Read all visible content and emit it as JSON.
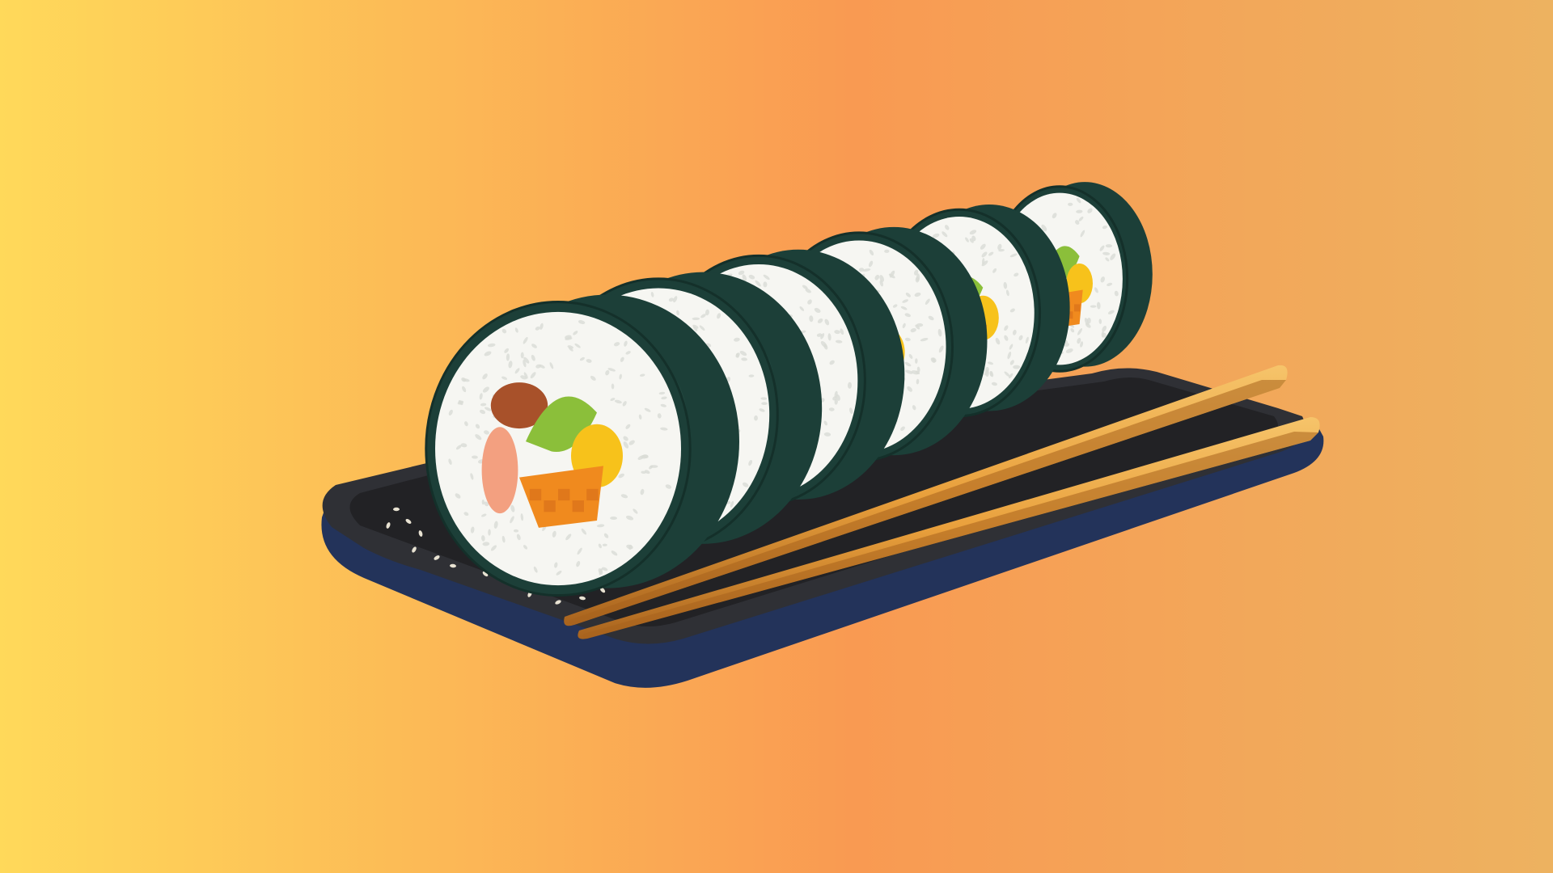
{
  "illustration": {
    "subject": "kimbap-rolls-on-plate-with-chopsticks",
    "slice_count": 6,
    "icons": [
      "kimbap-slice-icon",
      "plate-icon",
      "chopsticks-icon",
      "sesame-seed-icon"
    ]
  },
  "colors": {
    "background_left": "#FFD95A",
    "background_mid": "#F99A52",
    "background_right": "#EDB260",
    "seaweed": "#1C3F38",
    "seaweed_highlight": "#2E5A50",
    "rice": "#F6F6F2",
    "rice_shadow": "#D9DCD6",
    "carrot": "#F08A1E",
    "egg": "#F7C21B",
    "lettuce": "#8BBF3A",
    "ham": "#A8512A",
    "crab": "#F3A080",
    "plate_top": "#222225",
    "plate_rim": "#2F3035",
    "plate_side": "#23335A",
    "chopstick": "#E9A03C",
    "chopstick_shadow": "#A8631E",
    "sesame": "#E8E2D2"
  }
}
